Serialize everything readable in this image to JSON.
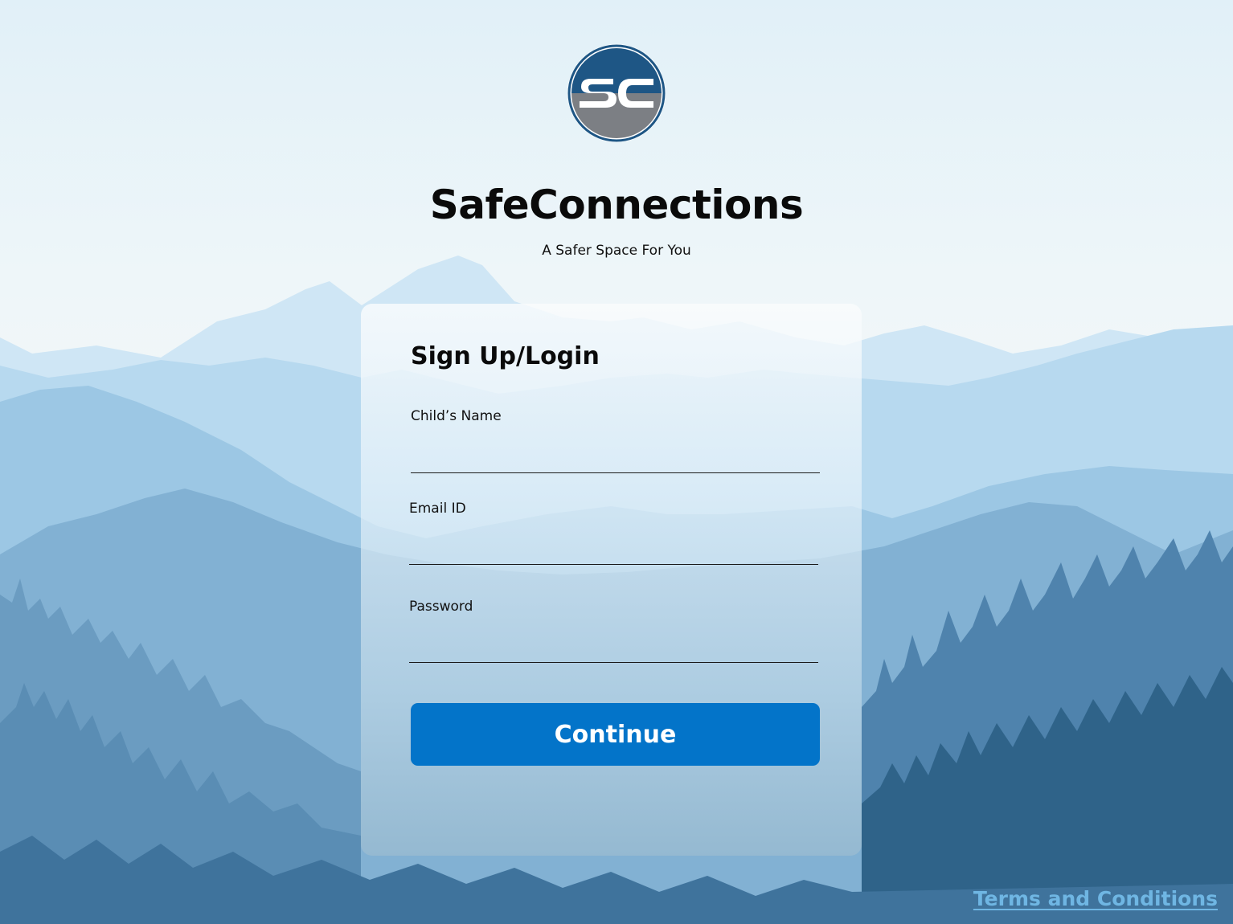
{
  "app": {
    "title": "SafeConnections",
    "subtitle": "A Safer Space For You",
    "logo_icon": "sc-monogram-logo"
  },
  "form": {
    "heading": "Sign Up/Login",
    "fields": [
      {
        "label": "Child’s Name",
        "value": "",
        "placeholder": ""
      },
      {
        "label": "Email ID",
        "value": "",
        "placeholder": ""
      },
      {
        "label": "Password",
        "value": "",
        "placeholder": ""
      }
    ],
    "submit_label": "Continue"
  },
  "footer": {
    "terms_label": "Terms and Conditions"
  },
  "colors": {
    "primary_button": "#0374c9",
    "link": "#6fb6e3",
    "logo_top": "#1e5685",
    "logo_bottom": "#7c7f84"
  },
  "background": {
    "scene": "mountain-forest-landscape"
  }
}
